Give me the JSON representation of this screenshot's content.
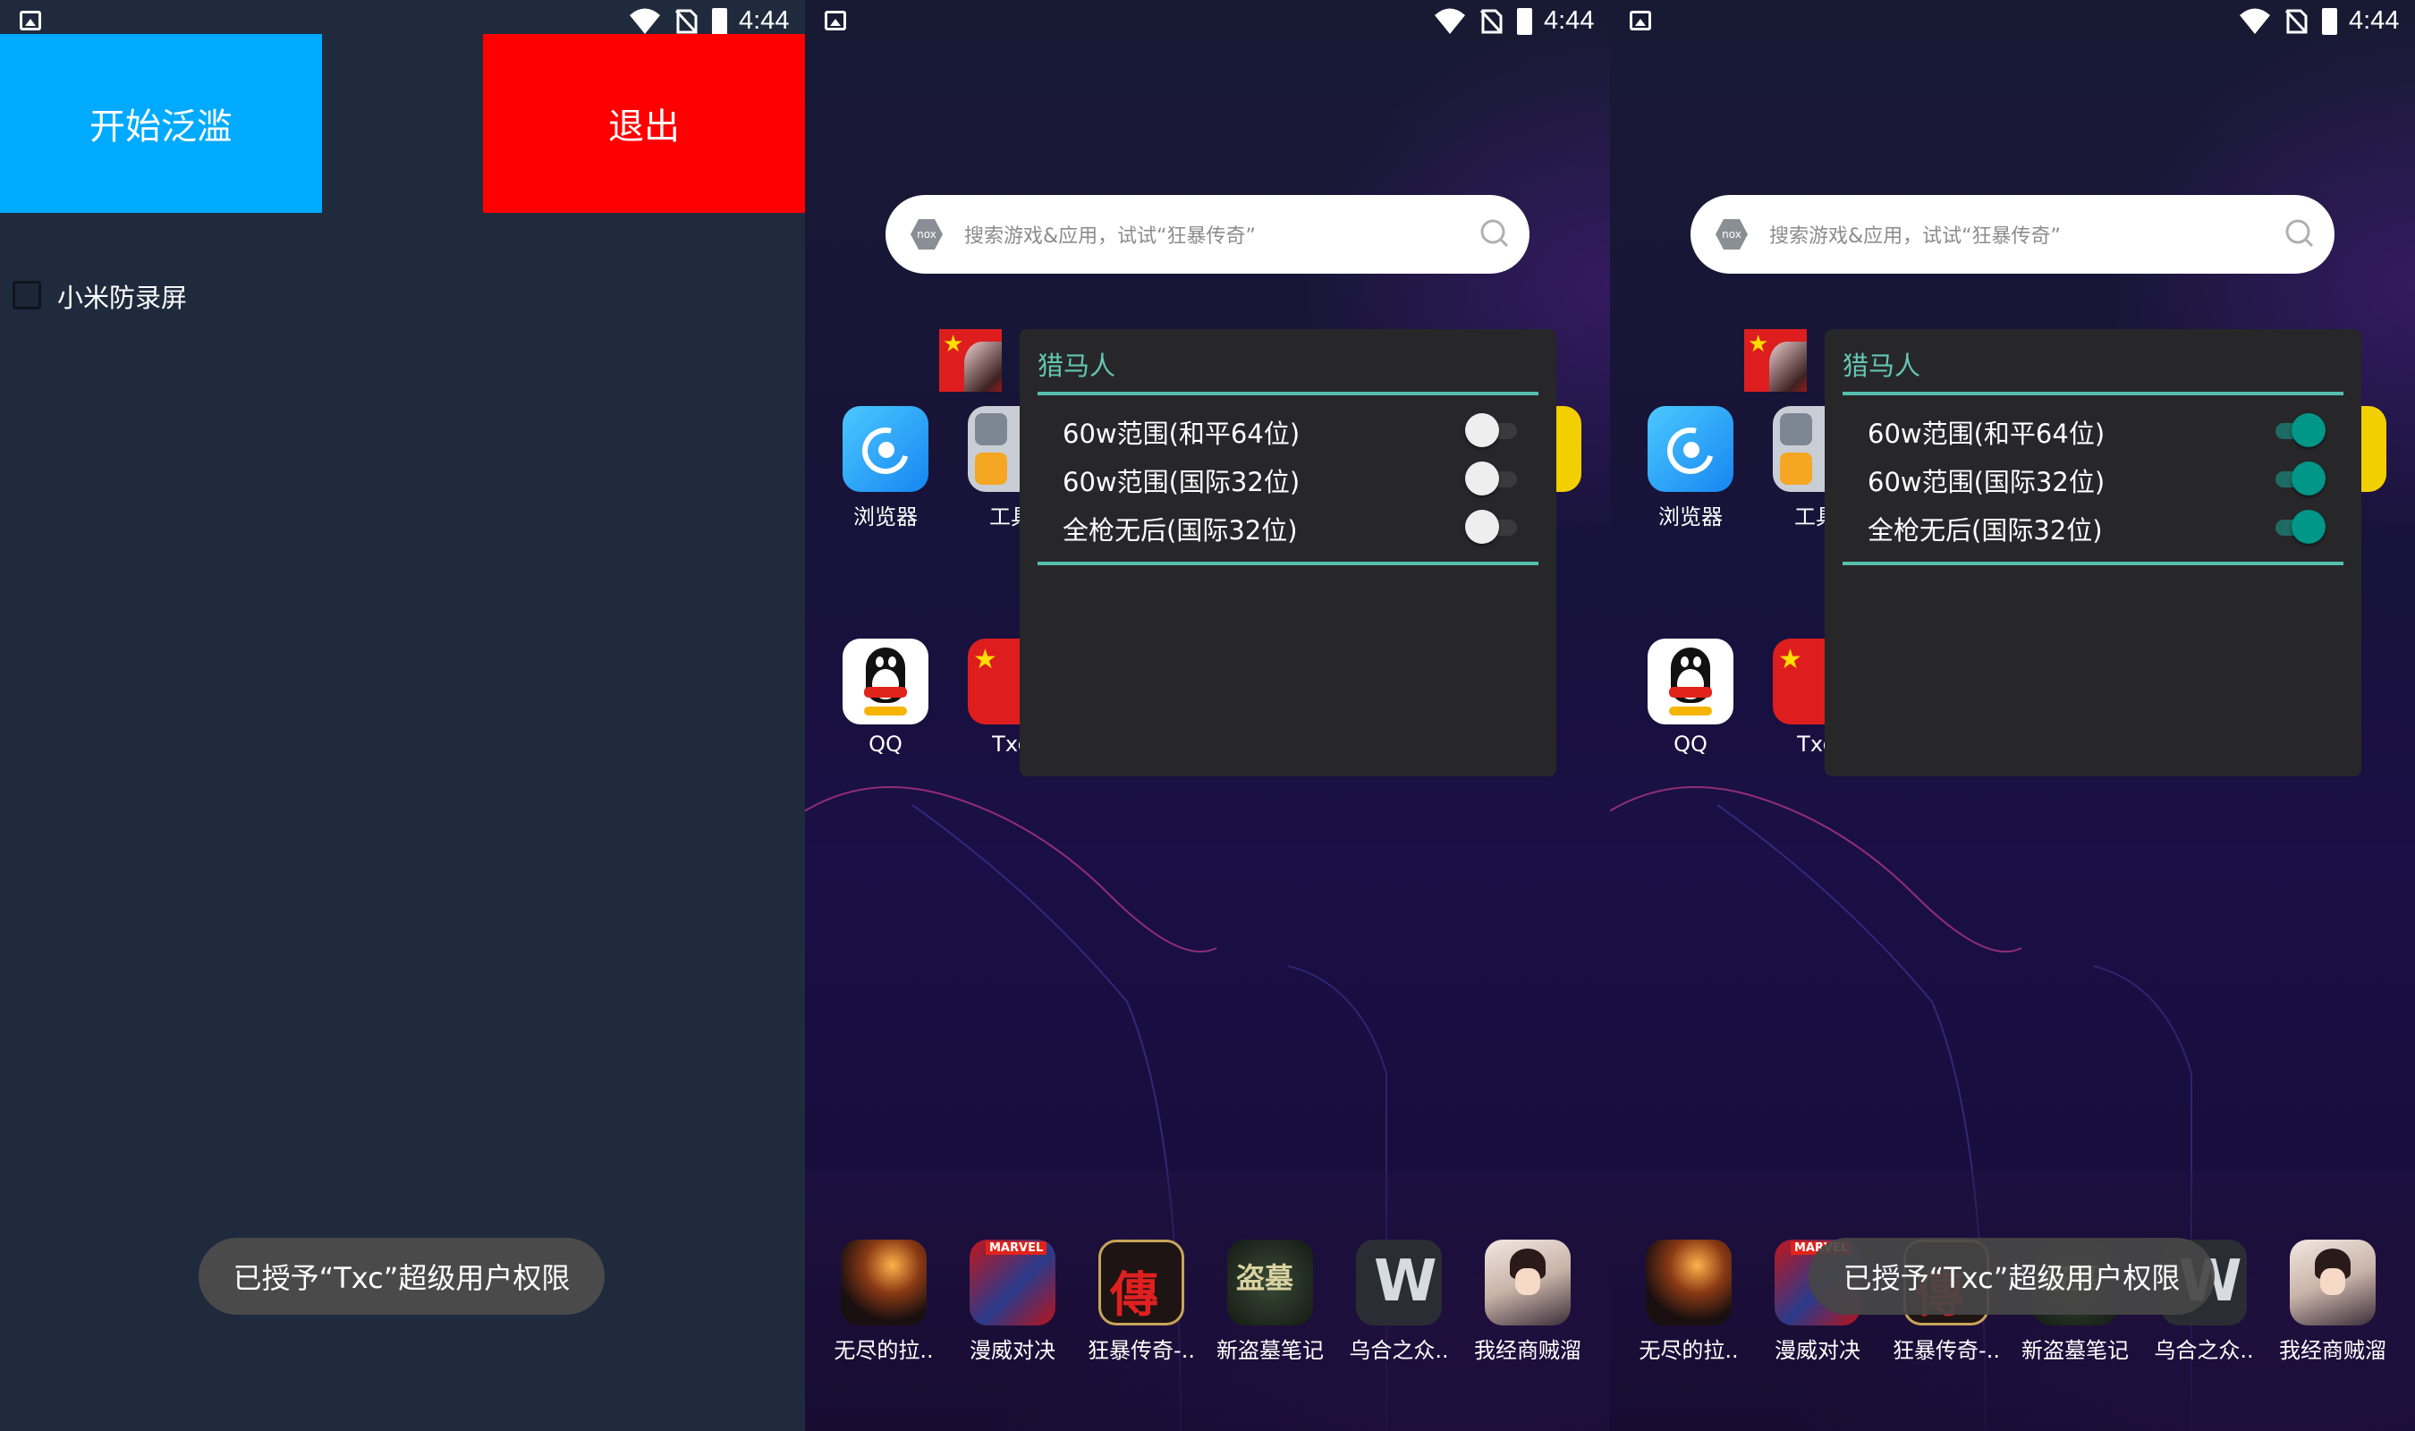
{
  "status_bar": {
    "time": "4:44"
  },
  "panel1": {
    "start_button": "开始泛滥",
    "exit_button": "退出",
    "checkbox_label": "小米防录屏",
    "toast": "已授予“Txc”超级用户权限"
  },
  "launcher": {
    "search_placeholder": "搜索游戏&应用，试试“狂暴传奇”",
    "search_logo": "nox",
    "apps": [
      {
        "label": "浏览器",
        "icon": "browser-icon"
      },
      {
        "label": "工具",
        "icon": "tools-folder-icon"
      },
      {
        "label": "QQ",
        "icon": "qq-icon"
      },
      {
        "label": "Txc",
        "icon": "txc-flag-icon"
      }
    ],
    "dock": [
      {
        "label": "无尽的拉..",
        "icon": "game-icon"
      },
      {
        "label": "漫威对决",
        "icon": "marvel-icon"
      },
      {
        "label": "狂暴传奇-..",
        "icon": "game-icon"
      },
      {
        "label": "新盗墓笔记",
        "icon": "game-icon"
      },
      {
        "label": "乌合之众..",
        "icon": "game-icon"
      },
      {
        "label": "我经商贼溜",
        "icon": "game-icon"
      }
    ]
  },
  "float_menu": {
    "title": "猎马人",
    "options": [
      {
        "label": "60w范围(和平64位)"
      },
      {
        "label": "60w范围(国际32位)"
      },
      {
        "label": "全枪无后(国际32位)"
      }
    ],
    "state_panel2": [
      false,
      false,
      false
    ],
    "state_panel3": [
      true,
      true,
      true
    ]
  },
  "colors": {
    "start_button": "#00aaff",
    "exit_button": "#ff0000",
    "accent": "#55bfae",
    "switch_on": "#009688"
  }
}
